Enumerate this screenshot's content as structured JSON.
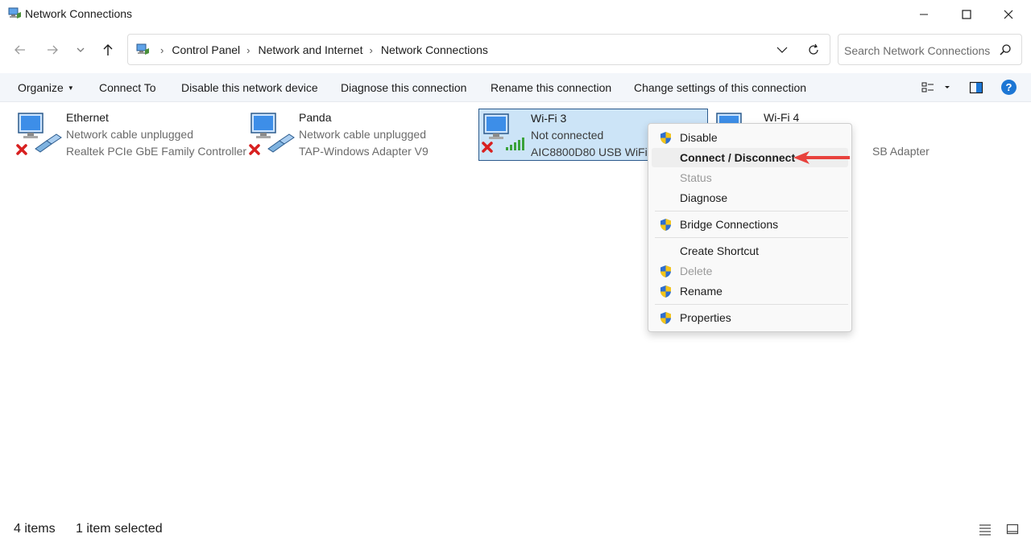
{
  "window": {
    "title": "Network Connections"
  },
  "address": {
    "crumbs": [
      "Control Panel",
      "Network and Internet",
      "Network Connections"
    ],
    "search_placeholder": "Search Network Connections"
  },
  "commands": {
    "organize": "Organize",
    "connect_to": "Connect To",
    "disable_device": "Disable this network device",
    "diagnose": "Diagnose this connection",
    "rename": "Rename this connection",
    "change_settings": "Change settings of this connection"
  },
  "help_label": "?",
  "items": [
    {
      "name": "Ethernet",
      "status": "Network cable unplugged",
      "device": "Realtek PCIe GbE Family Controller",
      "icon": "ethernet-disconnected-icon"
    },
    {
      "name": "Panda",
      "status": "Network cable unplugged",
      "device": "TAP-Windows Adapter V9",
      "icon": "ethernet-disconnected-icon"
    },
    {
      "name": "Wi-Fi 3",
      "status": "Not connected",
      "device": "AIC8800D80 USB WiFi",
      "icon": "wifi-disconnected-icon",
      "selected": true
    },
    {
      "name": "Wi-Fi 4",
      "status": "",
      "device": "SB Adapter",
      "icon": "wifi-icon"
    }
  ],
  "context_menu": {
    "items": [
      {
        "label": "Disable",
        "shield": true
      },
      {
        "label": "Connect / Disconnect",
        "bold": true,
        "highlighted": true
      },
      {
        "label": "Status",
        "disabled": true
      },
      {
        "label": "Diagnose"
      },
      {
        "label": "Bridge Connections",
        "shield": true
      },
      {
        "label": "Create Shortcut"
      },
      {
        "label": "Delete",
        "shield": true,
        "disabled": true
      },
      {
        "label": "Rename",
        "shield": true
      },
      {
        "label": "Properties",
        "shield": true
      }
    ]
  },
  "statusbar": {
    "item_count": "4 items",
    "selection": "1 item selected"
  },
  "colors": {
    "selection_bg": "#cce4f7",
    "annotation_arrow": "#e8413c",
    "shield_blue": "#2f6fd0",
    "shield_yellow": "#f5c518"
  }
}
